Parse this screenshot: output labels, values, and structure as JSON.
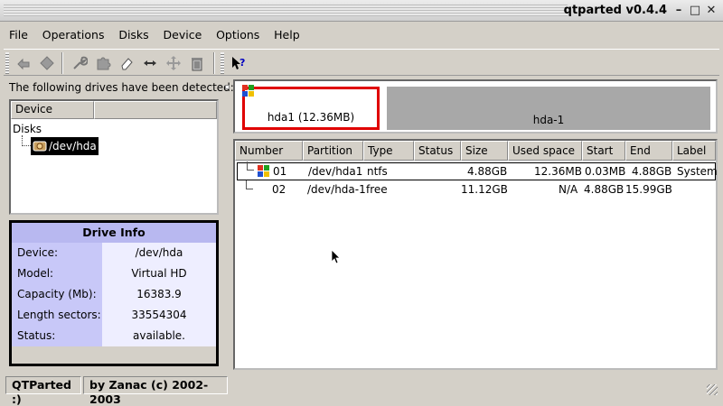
{
  "window": {
    "title": "qtparted v0.4.4"
  },
  "menu": {
    "file": "File",
    "operations": "Operations",
    "disks": "Disks",
    "device": "Device",
    "options": "Options",
    "help": "Help"
  },
  "toolbar_icons": [
    "undo-icon",
    "redo-icon",
    "wrench-icon",
    "puzzle-icon",
    "eraser-icon",
    "resize-icon",
    "move-icon",
    "trash-icon",
    "whats-this-icon"
  ],
  "left": {
    "drives_label": "The following drives have been detected:",
    "tree_header": "Device",
    "tree_root": "Disks",
    "tree_device": "/dev/hda"
  },
  "drive_info": {
    "title": "Drive Info",
    "rows": [
      {
        "key": "Device:",
        "value": "/dev/hda"
      },
      {
        "key": "Model:",
        "value": "Virtual HD"
      },
      {
        "key": "Capacity (Mb):",
        "value": "16383.9"
      },
      {
        "key": "Length sectors:",
        "value": "33554304"
      },
      {
        "key": "Status:",
        "value": "available."
      }
    ]
  },
  "partition_map": {
    "part1_label": "hda1 (12.36MB)",
    "part2_label": "hda-1"
  },
  "partition_table": {
    "columns": [
      "Number",
      "Partition",
      "Type",
      "Status",
      "Size",
      "Used space",
      "Start",
      "End",
      "Label"
    ],
    "rows": [
      {
        "number": "01",
        "partition": "/dev/hda1",
        "type": "ntfs",
        "status": "",
        "size": "4.88GB",
        "used": "12.36MB",
        "start": "0.03MB",
        "end": "4.88GB",
        "label": "System"
      },
      {
        "number": "02",
        "partition": "/dev/hda-1",
        "type": "free",
        "status": "",
        "size": "11.12GB",
        "used": "N/A",
        "start": "4.88GB",
        "end": "15.99GB",
        "label": ""
      }
    ]
  },
  "status": {
    "left": "QTParted :)",
    "right": "by Zanac (c) 2002-2003"
  },
  "colors": {
    "selection_red": "#e00000",
    "info_header": "#b8b8f0",
    "free_space": "#a8a8a8"
  }
}
